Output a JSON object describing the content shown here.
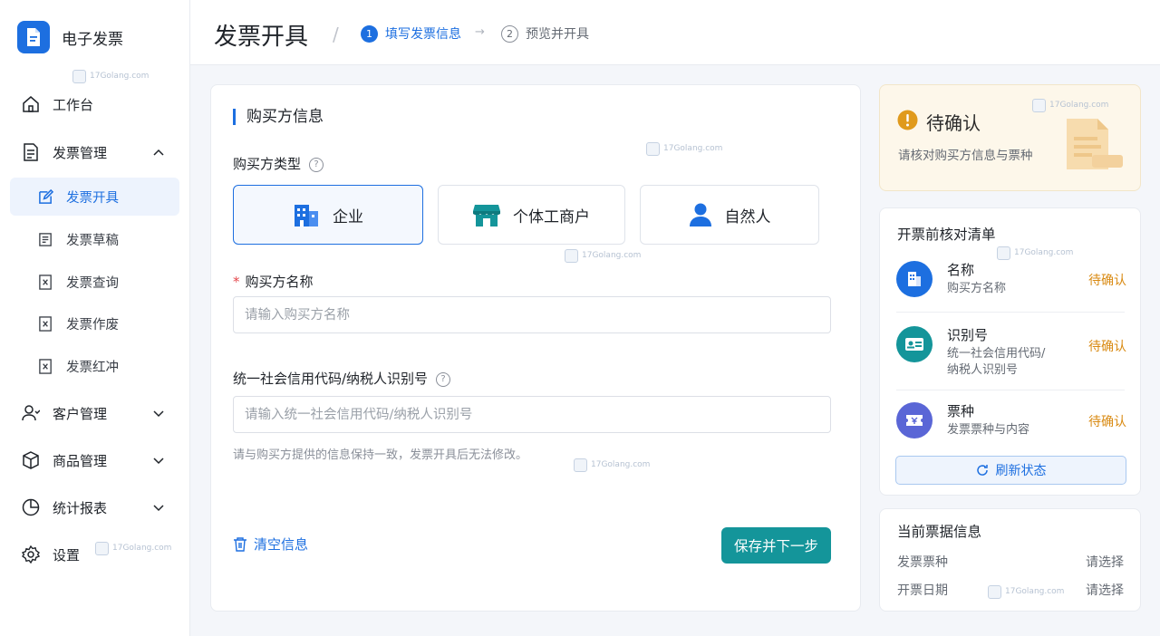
{
  "app": {
    "name": "电子发票",
    "watermark": "17Golang.com"
  },
  "sidebar": {
    "workbench": "工作台",
    "invoice_mgmt": "发票管理",
    "sub": [
      "发票开具",
      "发票草稿",
      "发票查询",
      "发票作废",
      "发票红冲"
    ],
    "customer_mgmt": "客户管理",
    "product_mgmt": "商品管理",
    "reports": "统计报表",
    "settings": "设置"
  },
  "header": {
    "title": "发票开具",
    "steps": [
      {
        "num": "1",
        "label": "填写发票信息",
        "active": true
      },
      {
        "num": "2",
        "label": "预览并开具",
        "active": false
      }
    ]
  },
  "form": {
    "section": "购买方信息",
    "buyer_type_label": "购买方类型",
    "types": [
      {
        "label": "企业",
        "icon": "building-icon",
        "selected": true
      },
      {
        "label": "个体工商户",
        "icon": "store-icon",
        "selected": false
      },
      {
        "label": "自然人",
        "icon": "person-icon",
        "selected": false
      }
    ],
    "name_required": "*",
    "name_label": "购买方名称",
    "name_placeholder": "请输入购买方名称",
    "name_value": "",
    "tax_label": "统一社会信用代码/纳税人识别号",
    "tax_placeholder": "请输入统一社会信用代码/纳税人识别号",
    "tax_value": "",
    "hint": "请与购买方提供的信息保持一致，发票开具后无法修改。",
    "clear": "清空信息",
    "save": "保存并下一步"
  },
  "status": {
    "title": "待确认",
    "desc": "请核对购买方信息与票种"
  },
  "checklist": {
    "title": "开票前核对清单",
    "items": [
      {
        "title": "名称",
        "desc1": "购买方名称",
        "desc2": "",
        "state": "待确认",
        "icon": "building-icon",
        "color": "#1d6fe0"
      },
      {
        "title": "识别号",
        "desc1": "统一社会信用代码/",
        "desc2": "纳税人识别号",
        "state": "待确认",
        "icon": "id-card-icon",
        "color": "#14959a"
      },
      {
        "title": "票种",
        "desc1": "发票票种与内容",
        "desc2": "",
        "state": "待确认",
        "icon": "ticket-icon",
        "color": "#5a66d6"
      }
    ],
    "refresh": "刷新状态"
  },
  "current": {
    "title": "当前票据信息",
    "rows": [
      {
        "k": "发票票种",
        "v": "请选择"
      },
      {
        "k": "开票日期",
        "v": "请选择"
      }
    ]
  },
  "colors": {
    "primary": "#1d6fe0",
    "teal": "#14959a",
    "warning": "#d98a12",
    "indigo": "#5a66d6"
  }
}
